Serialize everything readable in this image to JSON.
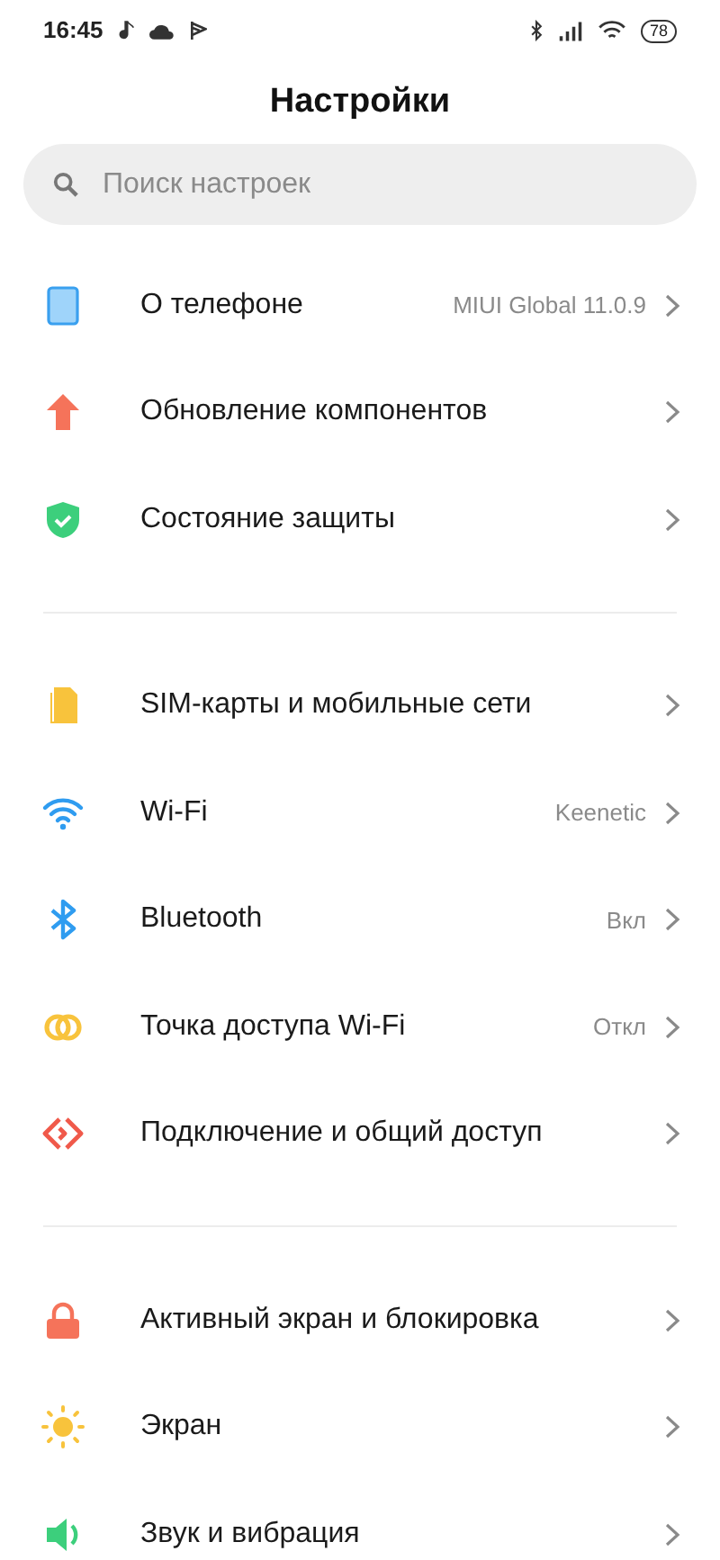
{
  "status_bar": {
    "time": "16:45",
    "battery": "78"
  },
  "title": "Настройки",
  "search": {
    "placeholder": "Поиск настроек"
  },
  "groups": [
    {
      "items": [
        {
          "label": "О телефоне",
          "value": "MIUI Global 11.0.9"
        },
        {
          "label": "Обновление компонентов"
        },
        {
          "label": "Состояние защиты"
        }
      ]
    },
    {
      "items": [
        {
          "label": "SIM-карты и мобильные сети"
        },
        {
          "label": "Wi-Fi",
          "value": "Keenetic"
        },
        {
          "label": "Bluetooth",
          "value": "Вкл"
        },
        {
          "label": "Точка доступа Wi-Fi",
          "value": "Откл"
        },
        {
          "label": "Подключение и общий доступ"
        }
      ]
    },
    {
      "items": [
        {
          "label": "Активный экран и блокировка"
        },
        {
          "label": "Экран"
        },
        {
          "label": "Звук и вибрация"
        }
      ]
    }
  ]
}
